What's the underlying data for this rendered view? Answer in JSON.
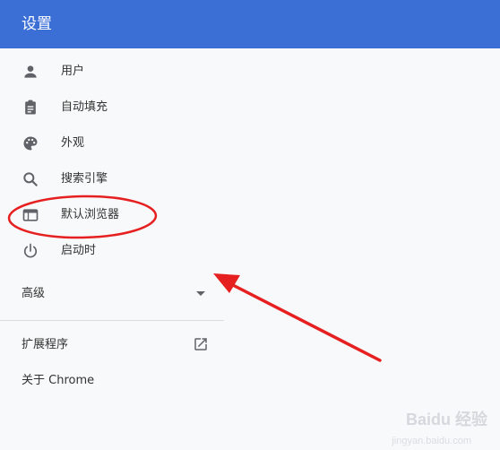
{
  "header": {
    "title": "设置"
  },
  "nav": {
    "items": [
      {
        "label": "用户",
        "icon": "person-icon"
      },
      {
        "label": "自动填充",
        "icon": "clipboard-icon"
      },
      {
        "label": "外观",
        "icon": "palette-icon"
      },
      {
        "label": "搜索引擎",
        "icon": "search-icon"
      },
      {
        "label": "默认浏览器",
        "icon": "browser-window-icon"
      },
      {
        "label": "启动时",
        "icon": "power-icon"
      }
    ],
    "advanced_label": "高级",
    "extensions_label": "扩展程序",
    "about_label": "关于 Chrome"
  },
  "watermark": {
    "text": "Baidu 经验",
    "sub": "jingyan.baidu.com"
  },
  "colors": {
    "header": "#3b6fd6",
    "annotation": "#e62020",
    "icon": "#5f6368"
  }
}
